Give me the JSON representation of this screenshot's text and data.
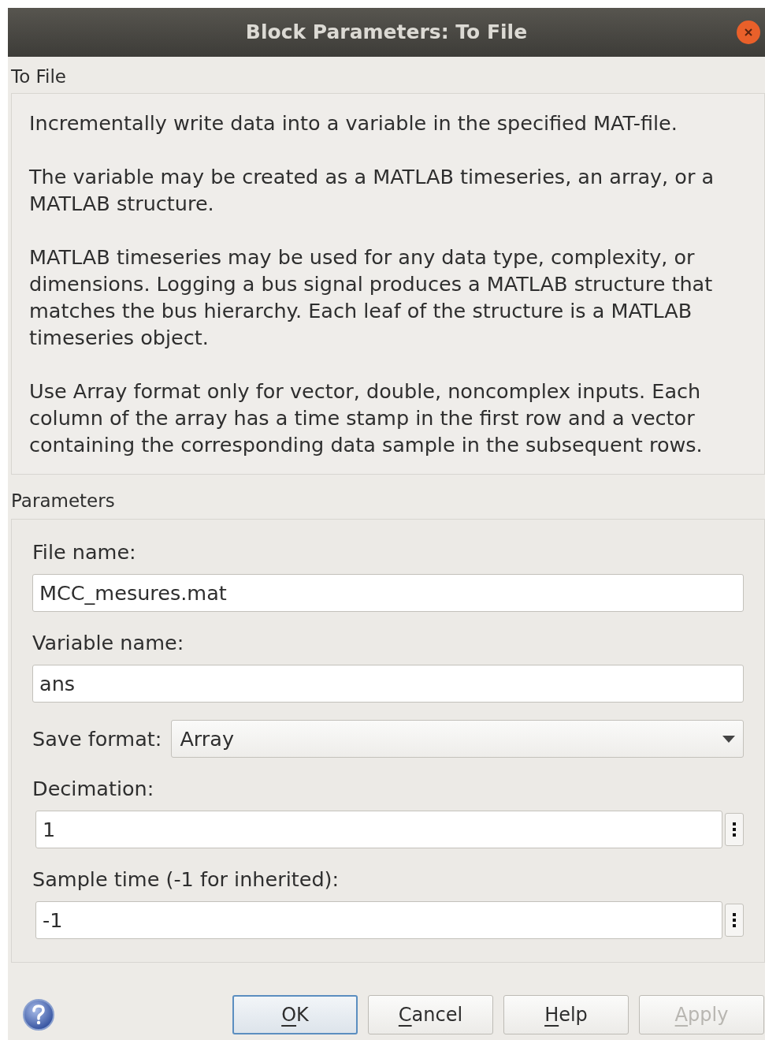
{
  "window": {
    "title": "Block Parameters: To File"
  },
  "block_name": "To File",
  "description": [
    "Incrementally write data into a variable in the specified MAT-file.",
    "The variable may be created as a MATLAB timeseries, an array, or a MATLAB structure.",
    "MATLAB timeseries may be used for any data type, complexity, or dimensions. Logging a bus signal produces a MATLAB structure that matches the bus hierarchy. Each leaf of the structure is a MATLAB timeseries object.",
    "Use Array format only for vector, double, noncomplex inputs. Each column of the array has a time stamp in the first row and a vector containing the corresponding data sample in the subsequent rows."
  ],
  "parameters_heading": "Parameters",
  "parameters": [
    {
      "kind": "text",
      "label": "File name:",
      "value": "MCC_mesures.mat"
    },
    {
      "kind": "text",
      "label": "Variable name:",
      "value": "ans"
    },
    {
      "kind": "dropdown",
      "label": "Save format:",
      "value": "Array"
    },
    {
      "kind": "text_with_menu",
      "label": "Decimation:",
      "value": "1"
    },
    {
      "kind": "text_with_menu",
      "label": "Sample time (-1 for inherited):",
      "value": "-1"
    }
  ],
  "buttons": [
    {
      "mnemonic": "O",
      "rest": "K",
      "default": true,
      "disabled": false
    },
    {
      "mnemonic": "C",
      "rest": "ancel",
      "default": false,
      "disabled": false
    },
    {
      "mnemonic": "H",
      "rest": "elp",
      "default": false,
      "disabled": false
    },
    {
      "mnemonic": "A",
      "rest": "pply",
      "default": false,
      "disabled": true
    }
  ]
}
